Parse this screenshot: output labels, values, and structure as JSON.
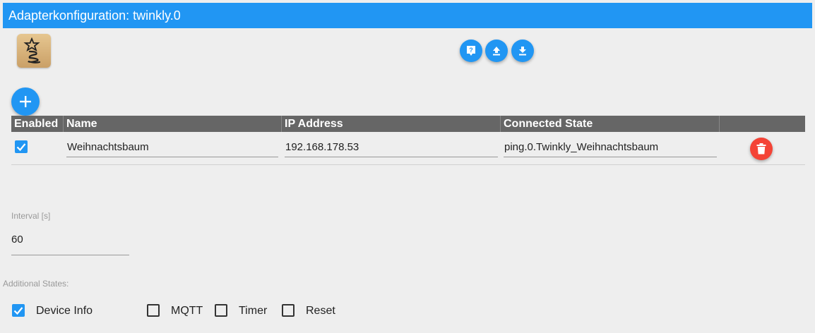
{
  "window": {
    "title": "Adapterkonfiguration: twinkly.0"
  },
  "logo": {
    "icon": "twinkly-logo-icon"
  },
  "toolbar": {
    "buttons": [
      {
        "icon": "help-icon"
      },
      {
        "icon": "upload-icon"
      },
      {
        "icon": "download-icon"
      }
    ]
  },
  "devices": {
    "add_icon": "plus-icon",
    "columns": [
      "Enabled",
      "Name",
      "IP Address",
      "Connected State"
    ],
    "rows": [
      {
        "enabled": true,
        "name": "Weihnachtsbaum",
        "ip": "192.168.178.53",
        "connected_state": "ping.0.Twinkly_Weihnachtsbaum",
        "delete_icon": "trash-icon"
      }
    ]
  },
  "interval": {
    "label": "Interval [s]",
    "value": "60"
  },
  "additional_states": {
    "label": "Additional States:",
    "options": [
      {
        "label": "Device Info",
        "checked": true
      },
      {
        "label": "MQTT",
        "checked": false
      },
      {
        "label": "Timer",
        "checked": false
      },
      {
        "label": "Reset",
        "checked": false
      }
    ]
  },
  "colors": {
    "primary": "#2196f3",
    "danger": "#f44336",
    "header_bg": "#666666",
    "background": "#eeeeee"
  }
}
